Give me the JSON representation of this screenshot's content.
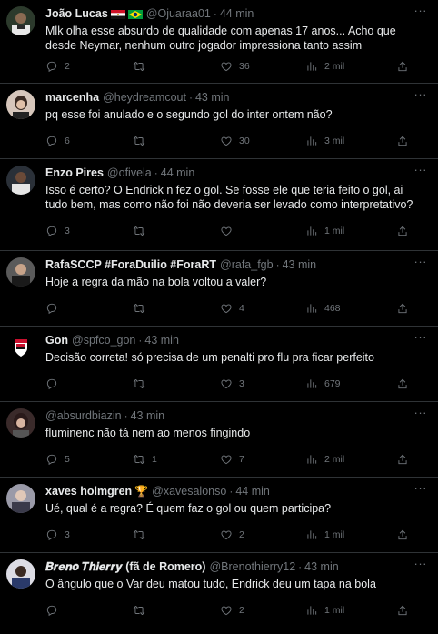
{
  "tweets": [
    {
      "name": "João Lucas",
      "handle": "@Ojuaraa01",
      "time": "44 min",
      "text": "Mlk olha esse absurdo de qualidade com apenas 17 anos... Acho que desde Neymar, nenhum outro jogador impressiona tanto assim",
      "replies": "2",
      "retweets": "",
      "likes": "36",
      "views": "2 mil",
      "avatar_color": "#3b4a3c"
    },
    {
      "name": "marcenha",
      "handle": "@heydreamcout",
      "time": "43 min",
      "text": "pq esse foi anulado e o segundo gol do inter ontem não?",
      "replies": "6",
      "retweets": "",
      "likes": "30",
      "views": "3 mil",
      "avatar_color": "#d9c8bd"
    },
    {
      "name": "Enzo Pires",
      "handle": "@ofivela",
      "time": "44 min",
      "text": "Isso é certo? O Endrick n fez o gol. Se fosse ele que teria feito o gol, ai tudo bem, mas como não foi não deveria ser levado como interpretativo?",
      "replies": "3",
      "retweets": "",
      "likes": "",
      "views": "1 mil",
      "avatar_color": "#6b5a4a"
    },
    {
      "name": "RafaSCCP #ForaDuilio #ForaRT",
      "handle": "@rafa_fgb",
      "time": "43 min",
      "text": "Hoje a regra da mão na bola voltou a valer?",
      "replies": "",
      "retweets": "",
      "likes": "4",
      "views": "468",
      "avatar_color": "#4a4a4a"
    },
    {
      "name": "Gon",
      "handle": "@spfco_gon",
      "time": "43 min",
      "text": "Decisão correta! só precisa de um penalti pro flu pra ficar perfeito",
      "replies": "",
      "retweets": "",
      "likes": "3",
      "views": "679",
      "avatar_color": "#111111"
    },
    {
      "name": "",
      "handle": "@absurdbiazin",
      "time": "43 min",
      "text": "fluminenc não tá nem ao menos fingindo",
      "replies": "5",
      "retweets": "1",
      "likes": "7",
      "views": "2 mil",
      "avatar_color": "#7a6a6a"
    },
    {
      "name": "xaves holmgren",
      "handle": "@xavesalonso",
      "time": "44 min",
      "text": "Ué, qual é a regra? É quem faz o gol ou quem participa?",
      "replies": "3",
      "retweets": "",
      "likes": "2",
      "views": "1 mil",
      "avatar_color": "#8a8a9a"
    },
    {
      "name": "𝑩𝒓𝒆𝒏𝒐 𝑻𝒉𝒊𝒆𝒓𝒓𝒚 (fã de Romero)",
      "handle": "@Brenothierry12",
      "time": "43 min",
      "text": "O ângulo que o Var deu matou tudo, Endrick deu um tapa na bola",
      "replies": "",
      "retweets": "",
      "likes": "2",
      "views": "1 mil",
      "avatar_color": "#c8c8d0"
    }
  ],
  "dot": "·",
  "more": "···",
  "trophy": "🏆"
}
